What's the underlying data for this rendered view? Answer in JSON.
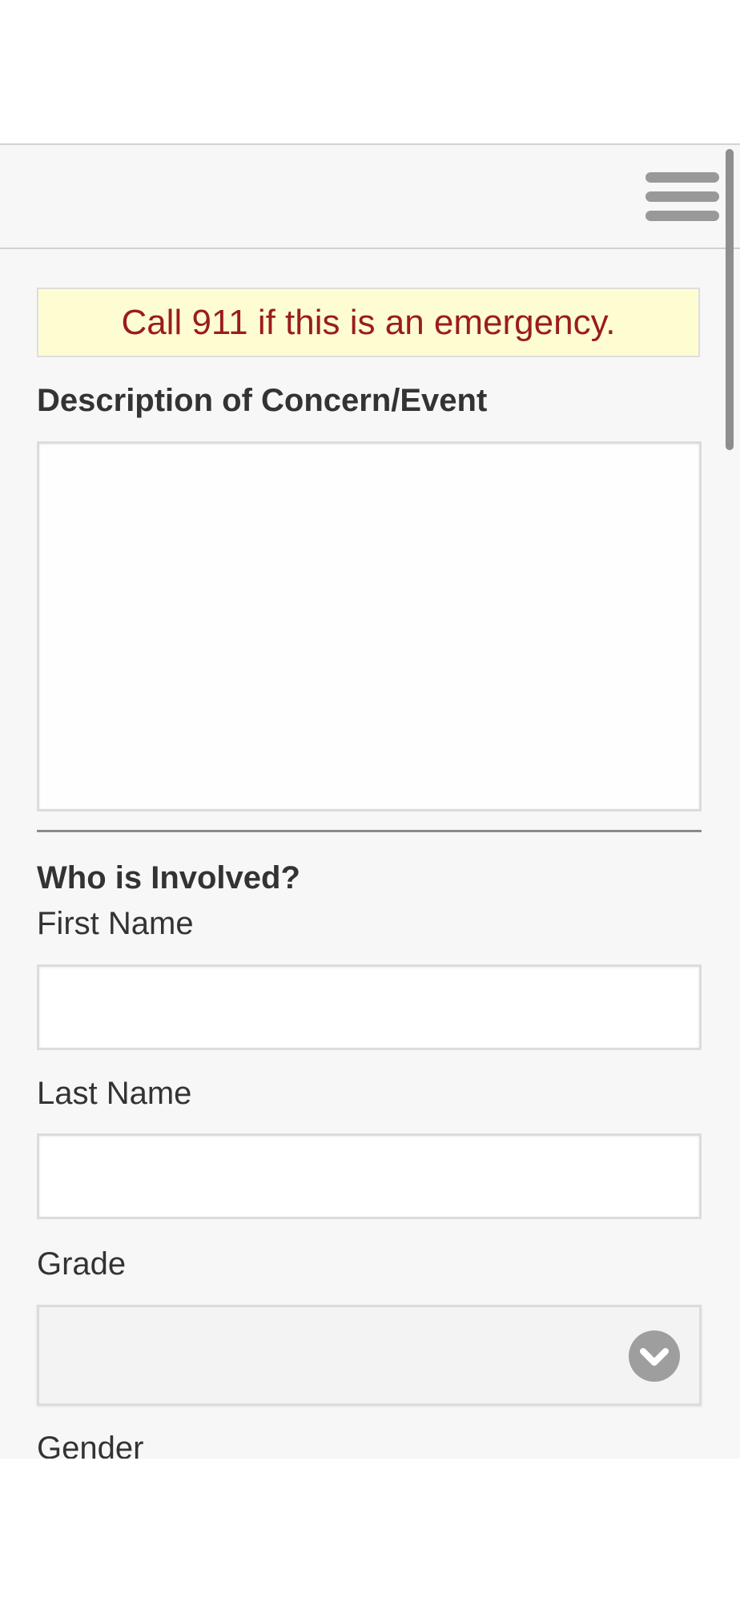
{
  "alert": {
    "text": "Call 911 if this is an emergency."
  },
  "form": {
    "description_label": "Description of Concern/Event",
    "description_value": "",
    "section_heading": "Who is Involved?",
    "first_name_label": "First Name",
    "first_name_value": "",
    "last_name_label": "Last Name",
    "last_name_value": "",
    "grade_label": "Grade",
    "grade_selected": "",
    "gender_label": "Gender"
  },
  "icons": {
    "menu": "hamburger-menu-icon",
    "select": "chevron-down-icon"
  },
  "colors": {
    "alert_background": "#fefdd2",
    "alert_text": "#9b1c1c",
    "page_background": "#f7f7f7",
    "menu_icon": "#999999"
  }
}
